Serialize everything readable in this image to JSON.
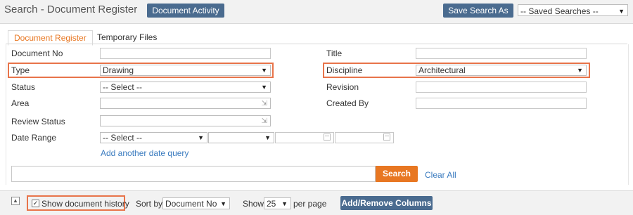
{
  "header": {
    "title": "Search - Document Register",
    "document_activity_label": "Document Activity",
    "save_search_as_label": "Save Search As",
    "saved_searches_value": "-- Saved Searches --"
  },
  "tabs": [
    {
      "label": "Document Register",
      "active": true
    },
    {
      "label": "Temporary Files",
      "active": false
    }
  ],
  "form": {
    "document_no_label": "Document No",
    "title_label": "Title",
    "type_label": "Type",
    "type_value": "Drawing",
    "discipline_label": "Discipline",
    "discipline_value": "Architectural",
    "status_label": "Status",
    "status_value": "-- Select --",
    "revision_label": "Revision",
    "area_label": "Area",
    "created_by_label": "Created By",
    "review_status_label": "Review Status",
    "date_range_label": "Date Range",
    "date_range_value": "-- Select --",
    "add_date_query_label": "Add another date query"
  },
  "search": {
    "button_label": "Search",
    "clear_all_label": "Clear All"
  },
  "footer": {
    "collapse_icon": "triangle-up-icon",
    "show_history_label": "Show document history",
    "show_history_checked": true,
    "sort_by_label": "Sort by",
    "sort_by_value": "Document No",
    "show_label": "Show",
    "page_size_value": "25",
    "per_page_label": "per page",
    "add_remove_columns_label": "Add/Remove Columns"
  },
  "colors": {
    "accent_orange": "#e87722",
    "button_blue": "#4a6b8f",
    "highlight_border": "#e8744a",
    "link_blue": "#3a7bbf"
  }
}
